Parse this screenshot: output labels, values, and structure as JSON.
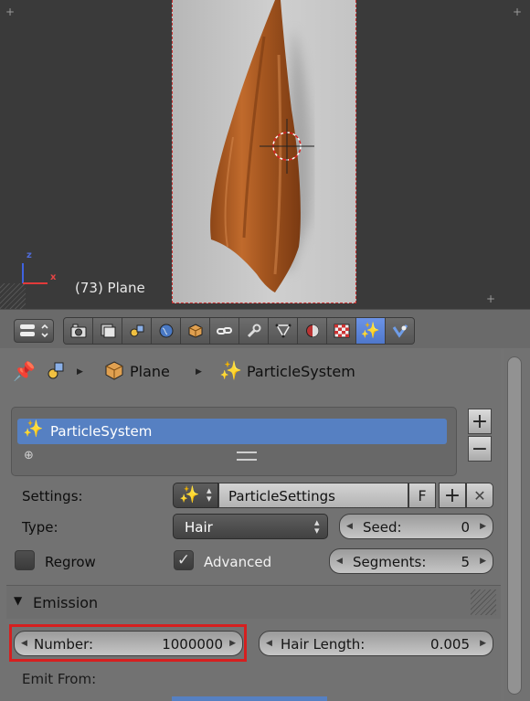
{
  "viewport": {
    "frame_label": "(73) Plane",
    "axis_z": "z",
    "axis_x": "x"
  },
  "header": {
    "editor_type_icon": "properties-editor-icon",
    "tabs": [
      {
        "name": "render",
        "icon": "camera-icon"
      },
      {
        "name": "render-layers",
        "icon": "render-layers-icon"
      },
      {
        "name": "scene",
        "icon": "scene-icon"
      },
      {
        "name": "world",
        "icon": "world-icon"
      },
      {
        "name": "object",
        "icon": "object-cube-icon"
      },
      {
        "name": "constraints",
        "icon": "constraints-icon"
      },
      {
        "name": "modifiers",
        "icon": "wrench-icon"
      },
      {
        "name": "data",
        "icon": "mesh-data-icon"
      },
      {
        "name": "material",
        "icon": "material-icon"
      },
      {
        "name": "texture",
        "icon": "texture-icon"
      },
      {
        "name": "particles",
        "icon": "particles-icon",
        "active": true
      },
      {
        "name": "physics",
        "icon": "physics-icon"
      }
    ]
  },
  "breadcrumb": {
    "object": "Plane",
    "particle_system": "ParticleSystem"
  },
  "particle_list": {
    "items": [
      "ParticleSystem"
    ],
    "add_label": "+",
    "remove_label": "−"
  },
  "settings": {
    "settings_label": "Settings:",
    "settings_value": "ParticleSettings",
    "fake_user_label": "F",
    "add_label": "+",
    "close_label": "✕",
    "type_label": "Type:",
    "type_value": "Hair",
    "seed_label": "Seed:",
    "seed_value": "0",
    "regrow_label": "Regrow",
    "regrow_checked": false,
    "advanced_label": "Advanced",
    "advanced_checked": true,
    "segments_label": "Segments:",
    "segments_value": "5"
  },
  "emission": {
    "title": "Emission",
    "number_label": "Number:",
    "number_value": "1000000",
    "hair_length_label": "Hair Length:",
    "hair_length_value": "0.005",
    "emit_from_label": "Emit From:"
  },
  "colors": {
    "accent": "#5680c2",
    "highlight_outline": "#d61f1f",
    "towel": "#b8642c"
  }
}
